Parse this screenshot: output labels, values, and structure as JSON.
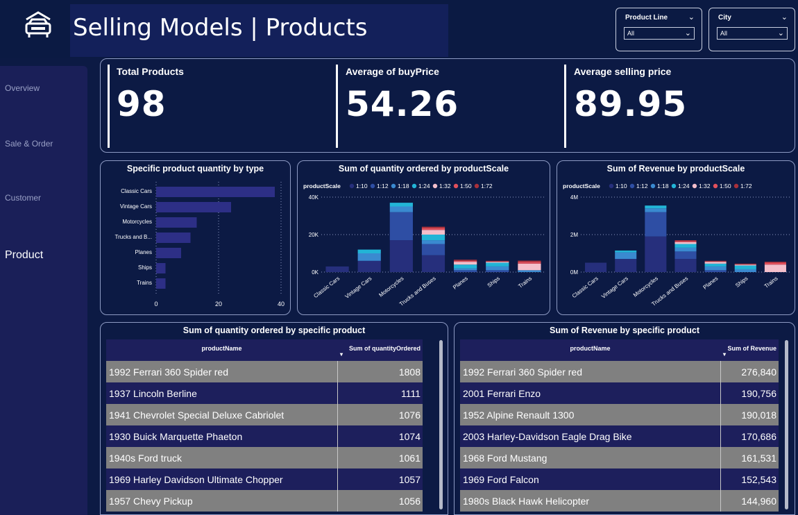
{
  "header": {
    "title": "Selling Models | Products",
    "logo_icon": "car-dealer-icon"
  },
  "slicers": [
    {
      "label": "Product Line",
      "value": "All"
    },
    {
      "label": "City",
      "value": "All"
    }
  ],
  "nav": {
    "items": [
      "Overview",
      "Sale & Order",
      "Customer",
      "Product"
    ],
    "active": "Product"
  },
  "kpis": [
    {
      "title": "Total Products",
      "value": "98"
    },
    {
      "title": "Average of buyPrice",
      "value": "54.26"
    },
    {
      "title": "Average selling price",
      "value": "89.95"
    }
  ],
  "colors": {
    "bar": "#2d2f86",
    "scales": [
      "#262f7c",
      "#2e4ea4",
      "#3a8ad0",
      "#22b4d6",
      "#f4bfcb",
      "#e2505c",
      "#a8303a"
    ]
  },
  "chart_data": [
    {
      "type": "bar",
      "title": "Specific product quantity by type",
      "orientation": "horizontal",
      "categories": [
        "Classic Cars",
        "Vintage Cars",
        "Motorcycles",
        "Trucks and B...",
        "Planes",
        "Ships",
        "Trains"
      ],
      "values": [
        38,
        24,
        13,
        11,
        8,
        3,
        3
      ],
      "xticks": [
        "0",
        "20",
        "40"
      ],
      "xlim": [
        0,
        40
      ]
    },
    {
      "type": "bar",
      "stacked": true,
      "title": "Sum of quantity ordered by productScale",
      "legend_title": "productScale",
      "series_names": [
        "1:10",
        "1:12",
        "1:18",
        "1:24",
        "1:32",
        "1:50",
        "1:72"
      ],
      "categories": [
        "Classic Cars",
        "Vintage Cars",
        "Motorcycles",
        "Trucks and Buses",
        "Planes",
        "Ships",
        "Trains"
      ],
      "stacks": [
        [
          3000,
          6000,
          17000,
          9000,
          0,
          0,
          0
        ],
        [
          0,
          0,
          15000,
          6000,
          1000,
          1000,
          0
        ],
        [
          0,
          4000,
          3000,
          2000,
          1000,
          2000,
          1000
        ],
        [
          0,
          2000,
          2000,
          3000,
          2000,
          2000,
          0
        ],
        [
          0,
          0,
          0,
          2500,
          1500,
          500,
          3500
        ],
        [
          0,
          0,
          0,
          1000,
          500,
          0,
          1000
        ],
        [
          0,
          0,
          0,
          700,
          600,
          500,
          600
        ]
      ],
      "yticks": [
        "0K",
        "20K",
        "40K"
      ],
      "ylim": [
        0,
        40000
      ]
    },
    {
      "type": "bar",
      "stacked": true,
      "title": "Sum of Revenue by productScale",
      "legend_title": "productScale",
      "series_names": [
        "1:10",
        "1:12",
        "1:18",
        "1:24",
        "1:32",
        "1:50",
        "1:72"
      ],
      "categories": [
        "Classic Cars",
        "Vintage Cars",
        "Motorcycles",
        "Trucks and Buses",
        "Planes",
        "Ships",
        "Trains"
      ],
      "stacks": [
        [
          500000,
          700000,
          1900000,
          700000,
          0,
          0,
          0
        ],
        [
          0,
          0,
          1300000,
          400000,
          100000,
          0,
          0
        ],
        [
          0,
          350000,
          200000,
          200000,
          200000,
          150000,
          0
        ],
        [
          0,
          100000,
          150000,
          200000,
          150000,
          200000,
          0
        ],
        [
          0,
          0,
          0,
          100000,
          100000,
          50000,
          400000
        ],
        [
          0,
          0,
          0,
          50000,
          0,
          0,
          100000
        ],
        [
          0,
          0,
          0,
          50000,
          50000,
          50000,
          50000
        ]
      ],
      "yticks": [
        "0M",
        "2M",
        "4M"
      ],
      "ylim": [
        0,
        4000000
      ]
    }
  ],
  "tables": [
    {
      "title": "Sum of quantity ordered by specific product",
      "columns": [
        "productName",
        "Sum of quantityOrdered"
      ],
      "rows": [
        [
          "1992 Ferrari 360 Spider red",
          "1808"
        ],
        [
          "1937 Lincoln Berline",
          "1111"
        ],
        [
          "1941 Chevrolet Special Deluxe Cabriolet",
          "1076"
        ],
        [
          "1930 Buick Marquette Phaeton",
          "1074"
        ],
        [
          "1940s Ford truck",
          "1061"
        ],
        [
          "1969 Harley Davidson Ultimate Chopper",
          "1057"
        ],
        [
          "1957 Chevy Pickup",
          "1056"
        ]
      ]
    },
    {
      "title": "Sum of Revenue by specific product",
      "columns": [
        "productName",
        "Sum of Revenue"
      ],
      "rows": [
        [
          "1992 Ferrari 360 Spider red",
          "276,840"
        ],
        [
          "2001 Ferrari Enzo",
          "190,756"
        ],
        [
          "1952 Alpine Renault 1300",
          "190,018"
        ],
        [
          "2003 Harley-Davidson Eagle Drag Bike",
          "170,686"
        ],
        [
          "1968 Ford Mustang",
          "161,531"
        ],
        [
          "1969 Ford Falcon",
          "152,543"
        ],
        [
          "1980s Black Hawk Helicopter",
          "144,960"
        ]
      ]
    }
  ]
}
